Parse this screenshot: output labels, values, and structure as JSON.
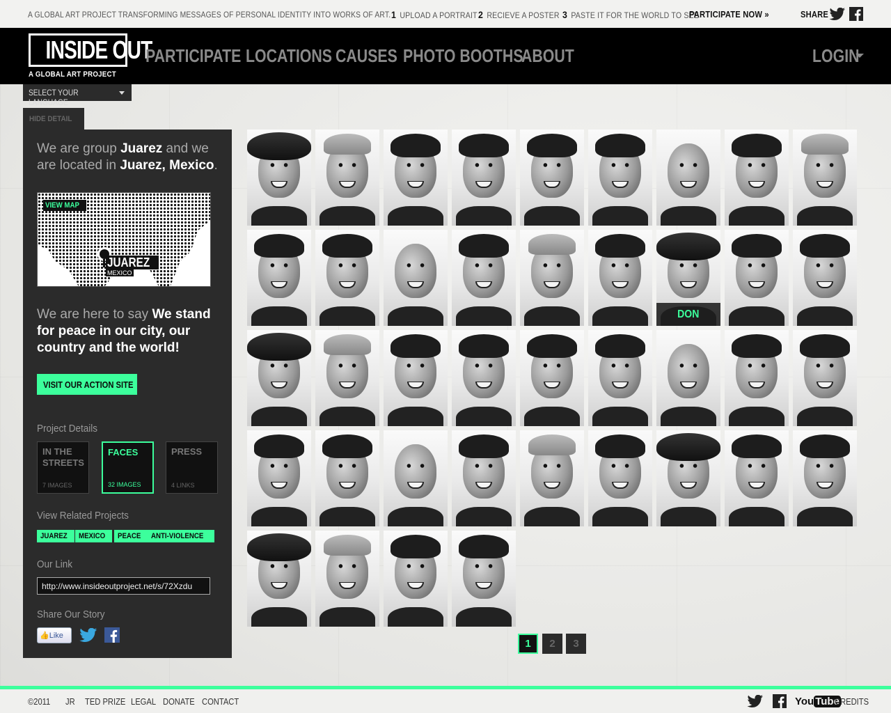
{
  "topbar": {
    "tagline": "A global art project transforming messages of personal identity into works of art.",
    "steps": [
      {
        "num": "1",
        "label": "Upload a portrait"
      },
      {
        "num": "2",
        "label": "Recieve a poster"
      },
      {
        "num": "3",
        "label": "Paste it for the world to see"
      }
    ],
    "participate_now": "Participate Now »",
    "share": "Share"
  },
  "brand": {
    "logo": "INSIDE OUT",
    "subtitle": "A GLOBAL ART PROJECT"
  },
  "nav": {
    "items": [
      "PARTICIPATE",
      "LOCATIONS",
      "CAUSES",
      "PHOTO BOOTHS",
      "ABOUT"
    ],
    "login": "LOGIN"
  },
  "language": {
    "label": "Select your language"
  },
  "panel": {
    "hide_detail": "HIDE DETAIL",
    "intro_pre": "We are group ",
    "group_name": "Juarez",
    "intro_mid": " and we are located in ",
    "location": "Juarez, Mexico",
    "intro_end": ".",
    "map": {
      "view_map": "VIEW MAP",
      "city": "JUAREZ",
      "country": "MEXICO"
    },
    "say_pre": "We are here to say ",
    "message": "We stand for peace in our city, our country and the world!",
    "action_button": "Visit our action site",
    "project_details_title": "Project Details",
    "tiles": [
      {
        "name": "IN THE STREETS",
        "count": "7 IMAGES",
        "active": false
      },
      {
        "name": "FACES",
        "count": "32 IMAGES",
        "active": true
      },
      {
        "name": "PRESS",
        "count": "4 LINKS",
        "active": false
      }
    ],
    "related_title": "View Related Projects",
    "tags": [
      "JUAREZ",
      "MEXICO",
      "PEACE",
      "ANTI-VIOLENCE"
    ],
    "link_title": "Our Link",
    "link_value": "http://www.insideoutproject.net/s/72Xzdu",
    "share_title": "Share Our Story",
    "like_label": "Like"
  },
  "grid": {
    "hover_name": "DON",
    "faces": [
      "hat",
      "cap",
      "hair",
      "hair",
      "hair",
      "hair",
      "bald",
      "hair",
      "cap",
      "hair",
      "hair",
      "bald",
      "hair",
      "cap",
      "hair",
      "hat",
      "hair",
      "hair",
      "hat",
      "cap",
      "hair",
      "hair",
      "hair",
      "hair",
      "bald",
      "hair",
      "hair",
      "hair",
      "hair",
      "bald",
      "hair",
      "cap",
      "hair",
      "hat",
      "hair",
      "hair",
      "hat",
      "cap",
      "hair",
      "hair"
    ]
  },
  "pagination": {
    "pages": [
      "1",
      "2",
      "3"
    ],
    "current": "1"
  },
  "footer": {
    "links": [
      "©2011",
      "JR",
      "TED PRIZE",
      "LEGAL",
      "DONATE",
      "CONTACT"
    ],
    "youtube_you": "You",
    "youtube_tube": "Tube",
    "credits": "CREDITS"
  },
  "colors": {
    "accent": "#3cff9c",
    "panel": "#2b2b2b",
    "nav": "#000000"
  }
}
